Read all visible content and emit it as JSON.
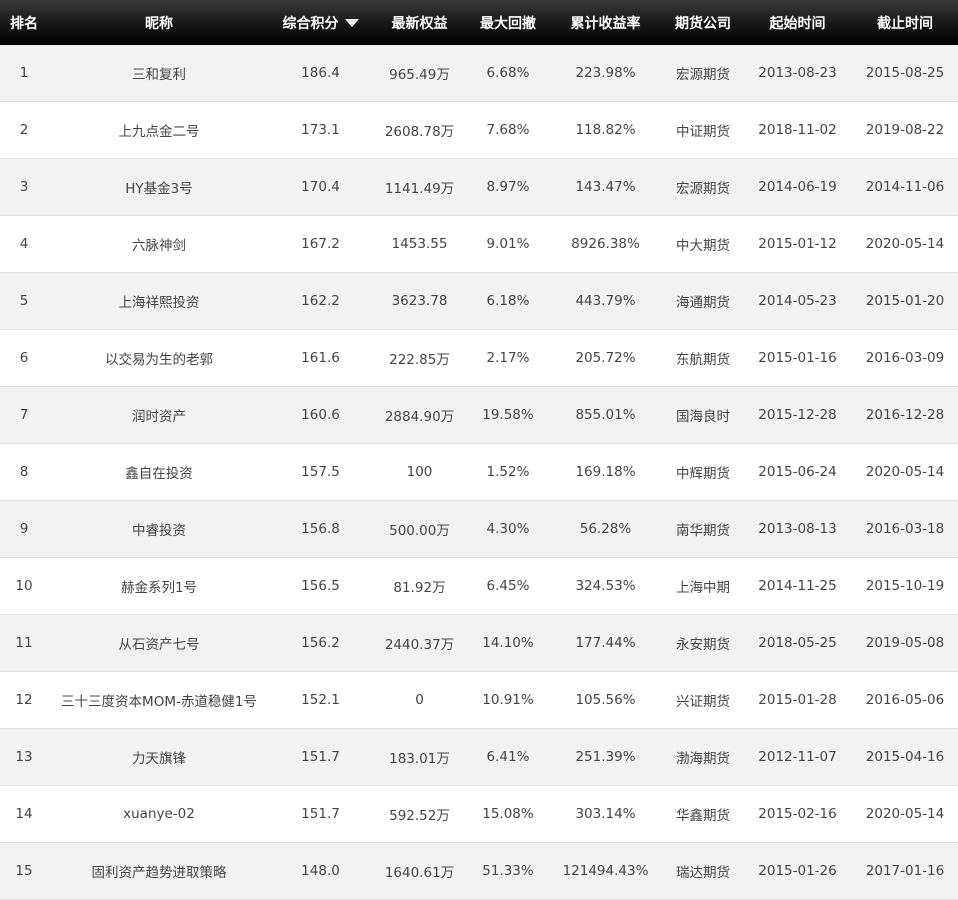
{
  "table": {
    "headers": {
      "rank": "排名",
      "nickname": "昵称",
      "score": "综合积分",
      "equity": "最新权益",
      "max_drawdown": "最大回撤",
      "cum_return": "累计收益率",
      "company": "期货公司",
      "start": "起始时间",
      "end": "截止时间"
    },
    "sort_icon": "caret-down-icon",
    "rows": [
      {
        "rank": "1",
        "nickname": "三和复利",
        "score": "186.4",
        "equity": "965.49万",
        "max_drawdown": "6.68%",
        "cum_return": "223.98%",
        "company": "宏源期货",
        "start": "2013-08-23",
        "end": "2015-08-25"
      },
      {
        "rank": "2",
        "nickname": "上九点金二号",
        "score": "173.1",
        "equity": "2608.78万",
        "max_drawdown": "7.68%",
        "cum_return": "118.82%",
        "company": "中证期货",
        "start": "2018-11-02",
        "end": "2019-08-22"
      },
      {
        "rank": "3",
        "nickname": "HY基金3号",
        "score": "170.4",
        "equity": "1141.49万",
        "max_drawdown": "8.97%",
        "cum_return": "143.47%",
        "company": "宏源期货",
        "start": "2014-06-19",
        "end": "2014-11-06"
      },
      {
        "rank": "4",
        "nickname": "六脉神剑",
        "score": "167.2",
        "equity": "1453.55",
        "max_drawdown": "9.01%",
        "cum_return": "8926.38%",
        "company": "中大期货",
        "start": "2015-01-12",
        "end": "2020-05-14"
      },
      {
        "rank": "5",
        "nickname": "上海祥熙投资",
        "score": "162.2",
        "equity": "3623.78",
        "max_drawdown": "6.18%",
        "cum_return": "443.79%",
        "company": "海通期货",
        "start": "2014-05-23",
        "end": "2015-01-20"
      },
      {
        "rank": "6",
        "nickname": "以交易为生的老郭",
        "score": "161.6",
        "equity": "222.85万",
        "max_drawdown": "2.17%",
        "cum_return": "205.72%",
        "company": "东航期货",
        "start": "2015-01-16",
        "end": "2016-03-09"
      },
      {
        "rank": "7",
        "nickname": "润时资产",
        "score": "160.6",
        "equity": "2884.90万",
        "max_drawdown": "19.58%",
        "cum_return": "855.01%",
        "company": "国海良时",
        "start": "2015-12-28",
        "end": "2016-12-28"
      },
      {
        "rank": "8",
        "nickname": "鑫自在投资",
        "score": "157.5",
        "equity": "100",
        "max_drawdown": "1.52%",
        "cum_return": "169.18%",
        "company": "中辉期货",
        "start": "2015-06-24",
        "end": "2020-05-14"
      },
      {
        "rank": "9",
        "nickname": "中睿投资",
        "score": "156.8",
        "equity": "500.00万",
        "max_drawdown": "4.30%",
        "cum_return": "56.28%",
        "company": "南华期货",
        "start": "2013-08-13",
        "end": "2016-03-18"
      },
      {
        "rank": "10",
        "nickname": "赫金系列1号",
        "score": "156.5",
        "equity": "81.92万",
        "max_drawdown": "6.45%",
        "cum_return": "324.53%",
        "company": "上海中期",
        "start": "2014-11-25",
        "end": "2015-10-19"
      },
      {
        "rank": "11",
        "nickname": "从石资产七号",
        "score": "156.2",
        "equity": "2440.37万",
        "max_drawdown": "14.10%",
        "cum_return": "177.44%",
        "company": "永安期货",
        "start": "2018-05-25",
        "end": "2019-05-08"
      },
      {
        "rank": "12",
        "nickname": "三十三度资本MOM-赤道稳健1号",
        "score": "152.1",
        "equity": "0",
        "max_drawdown": "10.91%",
        "cum_return": "105.56%",
        "company": "兴证期货",
        "start": "2015-01-28",
        "end": "2016-05-06"
      },
      {
        "rank": "13",
        "nickname": "力天旗锋",
        "score": "151.7",
        "equity": "183.01万",
        "max_drawdown": "6.41%",
        "cum_return": "251.39%",
        "company": "渤海期货",
        "start": "2012-11-07",
        "end": "2015-04-16"
      },
      {
        "rank": "14",
        "nickname": "xuanye-02",
        "score": "151.7",
        "equity": "592.52万",
        "max_drawdown": "15.08%",
        "cum_return": "303.14%",
        "company": "华鑫期货",
        "start": "2015-02-16",
        "end": "2020-05-14"
      },
      {
        "rank": "15",
        "nickname": "固利资产趋势进取策略",
        "score": "148.0",
        "equity": "1640.61万",
        "max_drawdown": "51.33%",
        "cum_return": "121494.43%",
        "company": "瑞达期货",
        "start": "2015-01-26",
        "end": "2017-01-16"
      }
    ]
  }
}
